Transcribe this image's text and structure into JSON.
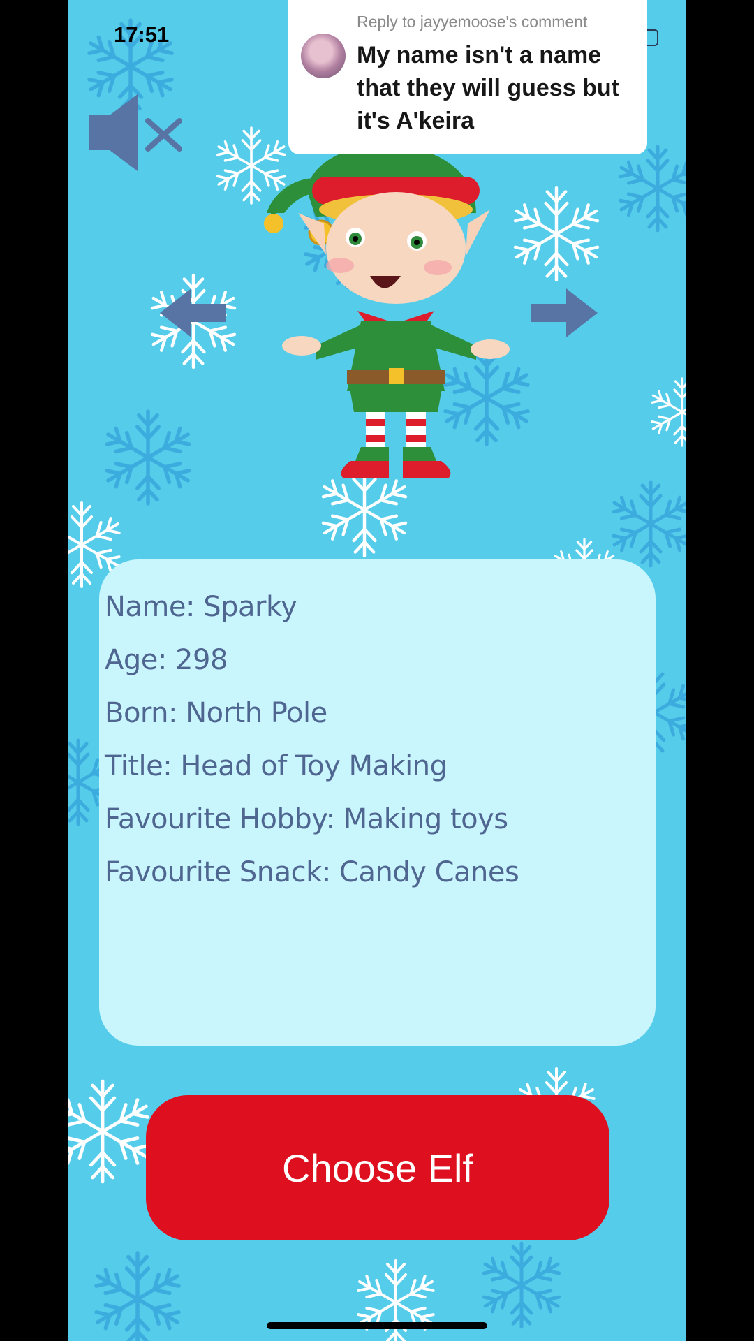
{
  "status_bar": {
    "time": "17:51"
  },
  "reply_comment": {
    "label": "Reply to jayyemoose's comment",
    "text": "My name isn't a name that they will guess but it's A'keira"
  },
  "controls": {
    "mute_icon": "speaker-muted-icon",
    "prev_icon": "arrow-left-icon",
    "next_icon": "arrow-right-icon"
  },
  "elf_profile": {
    "lines": [
      "Name: Sparky",
      "Age: 298",
      "Born: North Pole",
      "Title: Head of Toy Making",
      "Favourite Hobby: Making toys",
      "Favourite Snack: Candy Canes"
    ]
  },
  "choose_button": {
    "label": "Choose Elf"
  },
  "colors": {
    "background": "#55cdea",
    "card": "#c9f5fd",
    "card_text": "#4f6690",
    "button": "#de0f1f",
    "snowflake_white": "#ffffff",
    "snowflake_blue": "#3aa9dd"
  }
}
